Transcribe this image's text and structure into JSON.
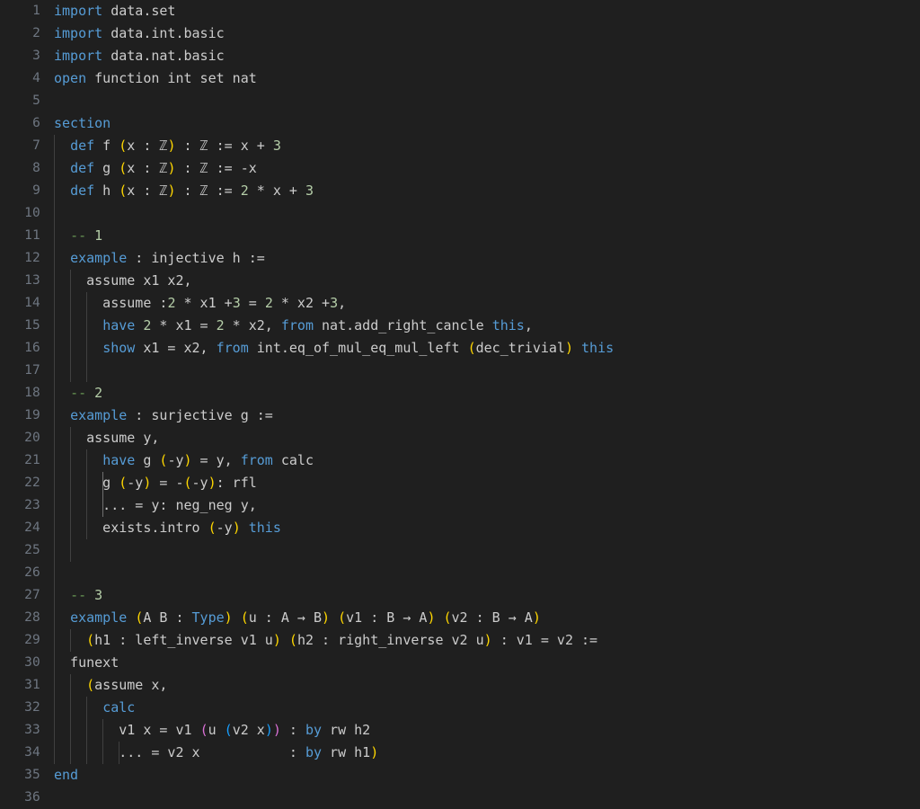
{
  "editor": {
    "theme_name": "dark-modern",
    "language": "lean",
    "background_color": "#1f1f1f",
    "foreground_color": "#cccccc",
    "line_number_color": "#6e7681",
    "indent_guide_color": "#404040",
    "indent_guide_active_color": "#707070",
    "colors": {
      "keyword": "#569cd6",
      "comment": "#6a9955",
      "number": "#b5cea8",
      "bracket_level_1": "#ffd700",
      "bracket_level_2": "#da70d6",
      "bracket_level_3": "#179fff"
    },
    "total_lines": 36,
    "line_height_px": 25,
    "first_visible_line": 1,
    "last_visible_line": 36
  },
  "lines": [
    {
      "n": "1",
      "indent": 0,
      "guides": []
    },
    {
      "n": "2",
      "indent": 0,
      "guides": []
    },
    {
      "n": "3",
      "indent": 0,
      "guides": []
    },
    {
      "n": "4",
      "indent": 0,
      "guides": []
    },
    {
      "n": "5",
      "indent": 0,
      "guides": []
    },
    {
      "n": "6",
      "indent": 0,
      "guides": []
    },
    {
      "n": "7",
      "indent": 1,
      "guides": [
        0
      ]
    },
    {
      "n": "8",
      "indent": 1,
      "guides": [
        0
      ]
    },
    {
      "n": "9",
      "indent": 1,
      "guides": [
        0
      ]
    },
    {
      "n": "10",
      "indent": 0,
      "guides": [
        0
      ]
    },
    {
      "n": "11",
      "indent": 1,
      "guides": [
        0
      ]
    },
    {
      "n": "12",
      "indent": 1,
      "guides": [
        0
      ]
    },
    {
      "n": "13",
      "indent": 2,
      "guides": [
        0,
        1
      ]
    },
    {
      "n": "14",
      "indent": 3,
      "guides": [
        0,
        1,
        2
      ]
    },
    {
      "n": "15",
      "indent": 3,
      "guides": [
        0,
        1,
        2
      ]
    },
    {
      "n": "16",
      "indent": 3,
      "guides": [
        0,
        1,
        2
      ]
    },
    {
      "n": "17",
      "indent": 0,
      "guides": [
        0,
        1,
        2
      ]
    },
    {
      "n": "18",
      "indent": 1,
      "guides": [
        0
      ]
    },
    {
      "n": "19",
      "indent": 1,
      "guides": [
        0
      ]
    },
    {
      "n": "20",
      "indent": 2,
      "guides": [
        0,
        1
      ]
    },
    {
      "n": "21",
      "indent": 3,
      "guides": [
        0,
        1,
        2
      ]
    },
    {
      "n": "22",
      "indent": 3,
      "guides": [
        0,
        1,
        2,
        3
      ]
    },
    {
      "n": "23",
      "indent": 3,
      "guides": [
        0,
        1,
        2,
        3
      ]
    },
    {
      "n": "24",
      "indent": 3,
      "guides": [
        0,
        1,
        2
      ]
    },
    {
      "n": "25",
      "indent": 0,
      "guides": [
        0,
        1
      ]
    },
    {
      "n": "26",
      "indent": 0,
      "guides": [
        0
      ]
    },
    {
      "n": "27",
      "indent": 1,
      "guides": [
        0
      ]
    },
    {
      "n": "28",
      "indent": 1,
      "guides": [
        0
      ]
    },
    {
      "n": "29",
      "indent": 2,
      "guides": [
        0,
        1
      ]
    },
    {
      "n": "30",
      "indent": 1,
      "guides": [
        0
      ]
    },
    {
      "n": "31",
      "indent": 2,
      "guides": [
        0,
        1
      ]
    },
    {
      "n": "32",
      "indent": 3,
      "guides": [
        0,
        1,
        2
      ]
    },
    {
      "n": "33",
      "indent": 4,
      "guides": [
        0,
        1,
        2,
        3
      ]
    },
    {
      "n": "34",
      "indent": 4,
      "guides": [
        0,
        1,
        2,
        3,
        4
      ]
    },
    {
      "n": "35",
      "indent": 0,
      "guides": []
    },
    {
      "n": "36",
      "indent": 0,
      "guides": []
    }
  ],
  "code_text": [
    "import data.set",
    "import data.int.basic",
    "import data.nat.basic",
    "open function int set nat",
    "",
    "section",
    "  def f (x : ℤ) : ℤ := x + 3",
    "  def g (x : ℤ) : ℤ := -x",
    "  def h (x : ℤ) : ℤ := 2 * x + 3",
    "",
    "  -- 1",
    "  example : injective h :=",
    "    assume x1 x2,",
    "      assume :2 * x1 +3 = 2 * x2 +3,",
    "      have 2 * x1 = 2 * x2, from nat.add_right_cancle this,",
    "      show x1 = x2, from int.eq_of_mul_eq_mul_left (dec_trivial) this",
    "",
    "  -- 2",
    "  example : surjective g :=",
    "    assume y,",
    "      have g (-y) = y, from calc",
    "      g (-y) = -(-y): rfl",
    "      ... = y: neg_neg y,",
    "      exists.intro (-y) this",
    "",
    "",
    "  -- 3",
    "  example (A B : Type) (u : A → B) (v1 : B → A) (v2 : B → A)",
    "    (h1 : left_inverse v1 u) (h2 : right_inverse v2 u) : v1 = v2 :=",
    "  funext",
    "    (assume x,",
    "      calc",
    "        v1 x = v1 (u (v2 x)) : by rw h2",
    "        ... = v2 x           : by rw h1)",
    "end",
    ""
  ],
  "tokens": [
    [
      {
        "t": "import",
        "c": "kw"
      },
      {
        "t": " data.set",
        "c": "pln"
      }
    ],
    [
      {
        "t": "import",
        "c": "kw"
      },
      {
        "t": " data.int.basic",
        "c": "pln"
      }
    ],
    [
      {
        "t": "import",
        "c": "kw"
      },
      {
        "t": " data.nat.basic",
        "c": "pln"
      }
    ],
    [
      {
        "t": "open",
        "c": "kw"
      },
      {
        "t": " function int set nat",
        "c": "pln"
      }
    ],
    [],
    [
      {
        "t": "section",
        "c": "kw"
      }
    ],
    [
      {
        "t": "  ",
        "c": "pln"
      },
      {
        "t": "def",
        "c": "kw"
      },
      {
        "t": " f ",
        "c": "pln"
      },
      {
        "t": "(",
        "c": "yel"
      },
      {
        "t": "x : ℤ",
        "c": "pln"
      },
      {
        "t": ")",
        "c": "yel"
      },
      {
        "t": " : ℤ := x + ",
        "c": "pln"
      },
      {
        "t": "3",
        "c": "num"
      }
    ],
    [
      {
        "t": "  ",
        "c": "pln"
      },
      {
        "t": "def",
        "c": "kw"
      },
      {
        "t": " g ",
        "c": "pln"
      },
      {
        "t": "(",
        "c": "yel"
      },
      {
        "t": "x : ℤ",
        "c": "pln"
      },
      {
        "t": ")",
        "c": "yel"
      },
      {
        "t": " : ℤ := -x",
        "c": "pln"
      }
    ],
    [
      {
        "t": "  ",
        "c": "pln"
      },
      {
        "t": "def",
        "c": "kw"
      },
      {
        "t": " h ",
        "c": "pln"
      },
      {
        "t": "(",
        "c": "yel"
      },
      {
        "t": "x : ℤ",
        "c": "pln"
      },
      {
        "t": ")",
        "c": "yel"
      },
      {
        "t": " : ℤ := ",
        "c": "pln"
      },
      {
        "t": "2",
        "c": "num"
      },
      {
        "t": " * x + ",
        "c": "pln"
      },
      {
        "t": "3",
        "c": "num"
      }
    ],
    [],
    [
      {
        "t": "  ",
        "c": "pln"
      },
      {
        "t": "-- ",
        "c": "cmt"
      },
      {
        "t": "1",
        "c": "num"
      }
    ],
    [
      {
        "t": "  ",
        "c": "pln"
      },
      {
        "t": "example",
        "c": "kw"
      },
      {
        "t": " : injective h :=",
        "c": "pln"
      }
    ],
    [
      {
        "t": "    assume x1 x2,",
        "c": "pln"
      }
    ],
    [
      {
        "t": "      assume :",
        "c": "pln"
      },
      {
        "t": "2",
        "c": "num"
      },
      {
        "t": " * x1 +",
        "c": "pln"
      },
      {
        "t": "3",
        "c": "num"
      },
      {
        "t": " = ",
        "c": "pln"
      },
      {
        "t": "2",
        "c": "num"
      },
      {
        "t": " * x2 +",
        "c": "pln"
      },
      {
        "t": "3",
        "c": "num"
      },
      {
        "t": ",",
        "c": "pln"
      }
    ],
    [
      {
        "t": "      ",
        "c": "pln"
      },
      {
        "t": "have",
        "c": "kw"
      },
      {
        "t": " ",
        "c": "pln"
      },
      {
        "t": "2",
        "c": "num"
      },
      {
        "t": " * x1 = ",
        "c": "pln"
      },
      {
        "t": "2",
        "c": "num"
      },
      {
        "t": " * x2, ",
        "c": "pln"
      },
      {
        "t": "from",
        "c": "kw"
      },
      {
        "t": " nat.add_right_cancle ",
        "c": "pln"
      },
      {
        "t": "this",
        "c": "kw"
      },
      {
        "t": ",",
        "c": "pln"
      }
    ],
    [
      {
        "t": "      ",
        "c": "pln"
      },
      {
        "t": "show",
        "c": "kw"
      },
      {
        "t": " x1 = x2, ",
        "c": "pln"
      },
      {
        "t": "from",
        "c": "kw"
      },
      {
        "t": " int.eq_of_mul_eq_mul_left ",
        "c": "pln"
      },
      {
        "t": "(",
        "c": "yel"
      },
      {
        "t": "dec_trivial",
        "c": "pln"
      },
      {
        "t": ")",
        "c": "yel"
      },
      {
        "t": " ",
        "c": "pln"
      },
      {
        "t": "this",
        "c": "kw"
      }
    ],
    [],
    [
      {
        "t": "  ",
        "c": "pln"
      },
      {
        "t": "-- ",
        "c": "cmt"
      },
      {
        "t": "2",
        "c": "num"
      }
    ],
    [
      {
        "t": "  ",
        "c": "pln"
      },
      {
        "t": "example",
        "c": "kw"
      },
      {
        "t": " : surjective g :=",
        "c": "pln"
      }
    ],
    [
      {
        "t": "    assume y,",
        "c": "pln"
      }
    ],
    [
      {
        "t": "      ",
        "c": "pln"
      },
      {
        "t": "have",
        "c": "kw"
      },
      {
        "t": " g ",
        "c": "pln"
      },
      {
        "t": "(",
        "c": "yel"
      },
      {
        "t": "-y",
        "c": "pln"
      },
      {
        "t": ")",
        "c": "yel"
      },
      {
        "t": " = y, ",
        "c": "pln"
      },
      {
        "t": "from",
        "c": "kw"
      },
      {
        "t": " calc",
        "c": "pln"
      }
    ],
    [
      {
        "t": "      g ",
        "c": "pln"
      },
      {
        "t": "(",
        "c": "yel"
      },
      {
        "t": "-y",
        "c": "pln"
      },
      {
        "t": ")",
        "c": "yel"
      },
      {
        "t": " = -",
        "c": "pln"
      },
      {
        "t": "(",
        "c": "yel"
      },
      {
        "t": "-y",
        "c": "pln"
      },
      {
        "t": ")",
        "c": "yel"
      },
      {
        "t": ": rfl",
        "c": "pln"
      }
    ],
    [
      {
        "t": "      ... = y: neg_neg y,",
        "c": "pln"
      }
    ],
    [
      {
        "t": "      exists.intro ",
        "c": "pln"
      },
      {
        "t": "(",
        "c": "yel"
      },
      {
        "t": "-y",
        "c": "pln"
      },
      {
        "t": ")",
        "c": "yel"
      },
      {
        "t": " ",
        "c": "pln"
      },
      {
        "t": "this",
        "c": "kw"
      }
    ],
    [],
    [],
    [
      {
        "t": "  ",
        "c": "pln"
      },
      {
        "t": "-- ",
        "c": "cmt"
      },
      {
        "t": "3",
        "c": "num"
      }
    ],
    [
      {
        "t": "  ",
        "c": "pln"
      },
      {
        "t": "example",
        "c": "kw"
      },
      {
        "t": " ",
        "c": "pln"
      },
      {
        "t": "(",
        "c": "yel"
      },
      {
        "t": "A B : ",
        "c": "pln"
      },
      {
        "t": "Type",
        "c": "kw"
      },
      {
        "t": ")",
        "c": "yel"
      },
      {
        "t": " ",
        "c": "pln"
      },
      {
        "t": "(",
        "c": "yel"
      },
      {
        "t": "u : A → B",
        "c": "pln"
      },
      {
        "t": ")",
        "c": "yel"
      },
      {
        "t": " ",
        "c": "pln"
      },
      {
        "t": "(",
        "c": "yel"
      },
      {
        "t": "v1 : B → A",
        "c": "pln"
      },
      {
        "t": ")",
        "c": "yel"
      },
      {
        "t": " ",
        "c": "pln"
      },
      {
        "t": "(",
        "c": "yel"
      },
      {
        "t": "v2 : B → A",
        "c": "pln"
      },
      {
        "t": ")",
        "c": "yel"
      }
    ],
    [
      {
        "t": "    ",
        "c": "pln"
      },
      {
        "t": "(",
        "c": "yel"
      },
      {
        "t": "h1 : left_inverse v1 u",
        "c": "pln"
      },
      {
        "t": ")",
        "c": "yel"
      },
      {
        "t": " ",
        "c": "pln"
      },
      {
        "t": "(",
        "c": "yel"
      },
      {
        "t": "h2 : right_inverse v2 u",
        "c": "pln"
      },
      {
        "t": ")",
        "c": "yel"
      },
      {
        "t": " : v1 = v2 :=",
        "c": "pln"
      }
    ],
    [
      {
        "t": "  funext",
        "c": "pln"
      }
    ],
    [
      {
        "t": "    ",
        "c": "pln"
      },
      {
        "t": "(",
        "c": "yel"
      },
      {
        "t": "assume x,",
        "c": "pln"
      }
    ],
    [
      {
        "t": "      ",
        "c": "pln"
      },
      {
        "t": "calc",
        "c": "kw"
      }
    ],
    [
      {
        "t": "        v1 x = v1 ",
        "c": "pln"
      },
      {
        "t": "(",
        "c": "mag"
      },
      {
        "t": "u ",
        "c": "pln"
      },
      {
        "t": "(",
        "c": "blu"
      },
      {
        "t": "v2 x",
        "c": "pln"
      },
      {
        "t": ")",
        "c": "blu"
      },
      {
        "t": ")",
        "c": "mag"
      },
      {
        "t": " : ",
        "c": "pln"
      },
      {
        "t": "by",
        "c": "kw"
      },
      {
        "t": " rw h2",
        "c": "pln"
      }
    ],
    [
      {
        "t": "        ... = v2 x           : ",
        "c": "pln"
      },
      {
        "t": "by",
        "c": "kw"
      },
      {
        "t": " rw h1",
        "c": "pln"
      },
      {
        "t": ")",
        "c": "yel"
      }
    ],
    [
      {
        "t": "end",
        "c": "kw"
      }
    ],
    []
  ]
}
